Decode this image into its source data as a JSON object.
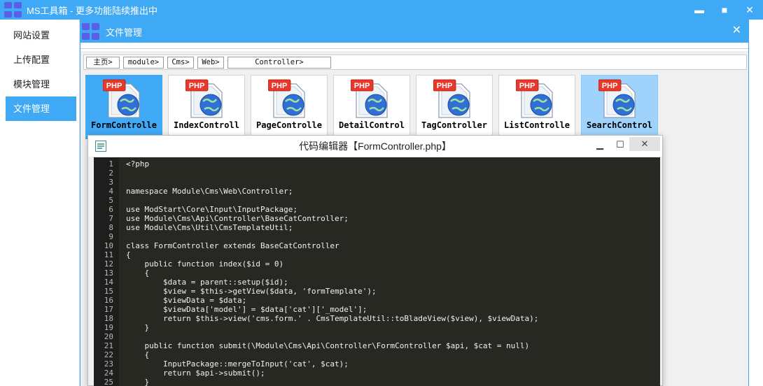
{
  "app": {
    "title": "MS工具箱 - 更多功能陆续推出中",
    "window_controls": [
      "▬",
      "■",
      "✕"
    ]
  },
  "sidebar": {
    "items": [
      {
        "label": "网站设置",
        "active": false
      },
      {
        "label": "上传配置",
        "active": false
      },
      {
        "label": "模块管理",
        "active": false
      },
      {
        "label": "文件管理",
        "active": true
      }
    ]
  },
  "file_manager": {
    "title": "文件管理",
    "close": "✕",
    "breadcrumb": [
      "主页>",
      "module>",
      "Cms>",
      "Web>",
      "Controller>"
    ],
    "files": [
      {
        "name": "FormController.php",
        "label": "FormControlle",
        "icon": "php-file-icon",
        "state": "selected"
      },
      {
        "name": "IndexController.php",
        "label": "IndexControll",
        "icon": "php-file-icon",
        "state": "normal"
      },
      {
        "name": "PageController.php",
        "label": "PageControlle",
        "icon": "php-file-icon",
        "state": "normal"
      },
      {
        "name": "DetailController.php",
        "label": "DetailControl",
        "icon": "php-file-icon",
        "state": "normal"
      },
      {
        "name": "TagController.php",
        "label": "TagController",
        "icon": "php-file-icon",
        "state": "normal"
      },
      {
        "name": "ListController.php",
        "label": "ListControlle",
        "icon": "php-file-icon",
        "state": "normal"
      },
      {
        "name": "SearchController.php",
        "label": "SearchControl",
        "icon": "php-file-icon",
        "state": "hover"
      }
    ]
  },
  "editor": {
    "title": "代码编辑器【FormController.php】",
    "controls": {
      "minimize": "▁",
      "maximize": "☐",
      "close": "✕"
    },
    "lines": [
      "<?php",
      "",
      "",
      "namespace Module\\Cms\\Web\\Controller;",
      "",
      "use ModStart\\Core\\Input\\InputPackage;",
      "use Module\\Cms\\Api\\Controller\\BaseCatController;",
      "use Module\\Cms\\Util\\CmsTemplateUtil;",
      "",
      "class FormController extends BaseCatController",
      "{",
      "    public function index($id = 0)",
      "    {",
      "        $data = parent::setup($id);",
      "        $view = $this->getView($data, 'formTemplate');",
      "        $viewData = $data;",
      "        $viewData['model'] = $data['cat']['_model'];",
      "        return $this->view('cms.form.' . CmsTemplateUtil::toBladeView($view), $viewData);",
      "    }",
      "",
      "    public function submit(\\Module\\Cms\\Api\\Controller\\FormController $api, $cat = null)",
      "    {",
      "        InputPackage::mergeToInput('cat', $cat);",
      "        return $api->submit();",
      "    }",
      "}"
    ]
  },
  "colors": {
    "accent": "#3fa9f5",
    "editor_bg": "#272822",
    "logo": "#5b5fe8",
    "php_badge": "#e8382a"
  }
}
